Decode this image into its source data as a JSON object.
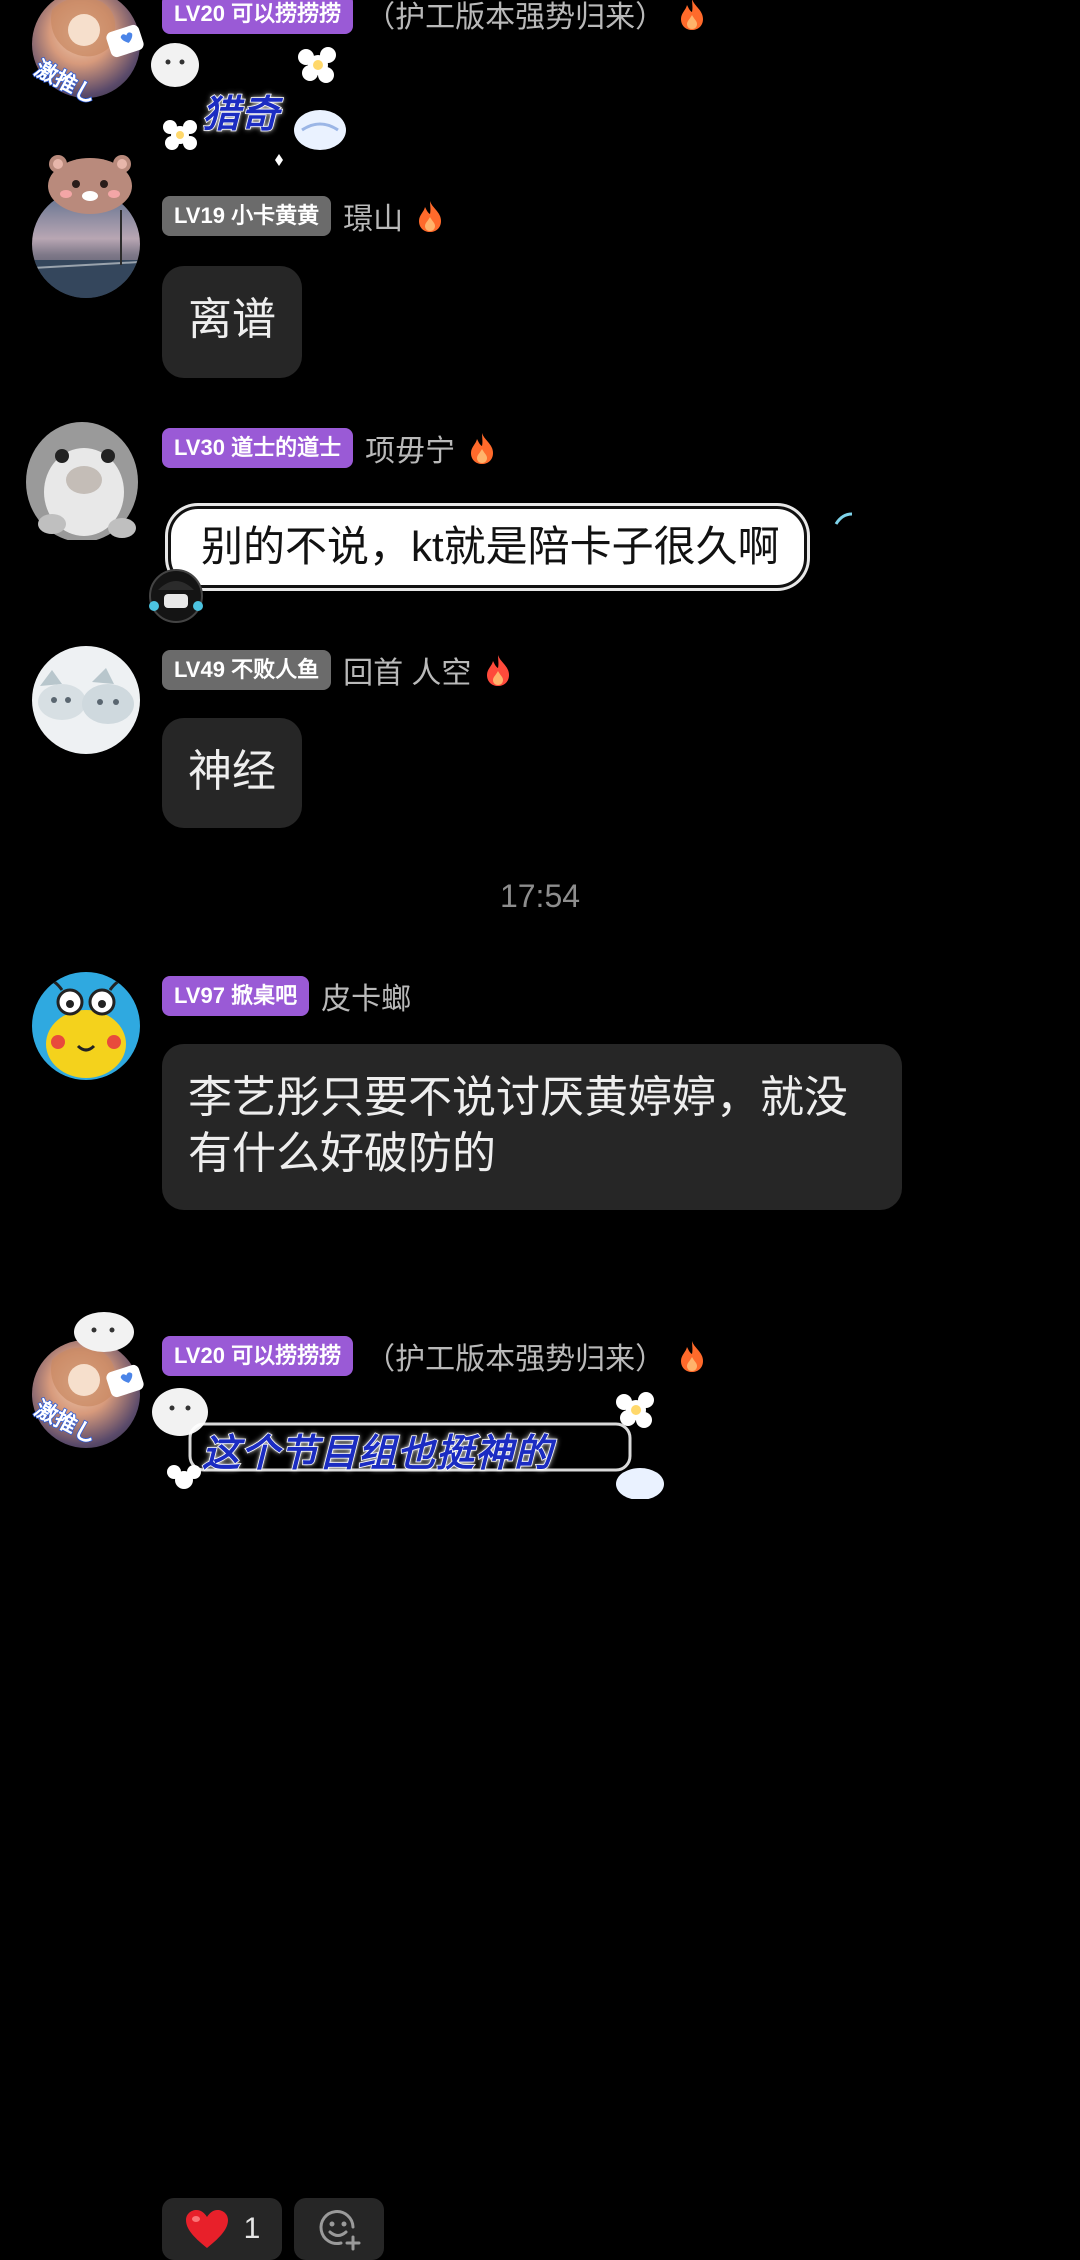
{
  "messages": [
    {
      "id": "m1",
      "badge": "LV20 可以捞捞捞",
      "name": "（护工版本强势归来）",
      "sticker_text": "猎奇",
      "frame_text": "激推し"
    },
    {
      "id": "m2",
      "badge": "LV19 小卡黄黄",
      "name": "璟山",
      "text": "离谱"
    },
    {
      "id": "m3",
      "badge": "LV30 道士的道士",
      "name": "项毋宁",
      "text": "别的不说，kt就是陪卡子很久啊"
    },
    {
      "id": "m4",
      "badge": "LV49 不败人鱼",
      "name": "回首 人空",
      "text": "神经"
    },
    {
      "id": "m5",
      "badge": "LV97 掀桌吧",
      "name": "皮卡螂",
      "text_line1": "李艺彤只要不说讨厌黄婷婷，就没",
      "text_line2": "有什么好破防的",
      "reaction_count": "1"
    },
    {
      "id": "m6",
      "badge": "LV20 可以捞捞捞",
      "name": "（护工版本强势归来）",
      "sticker_text": "这个节目组也挺神的",
      "frame_text": "激推し"
    }
  ],
  "timestamp": "17:54",
  "colors": {
    "background": "#000000",
    "badge_purple": "#9a5ad6",
    "badge_gray": "#6b6b6b",
    "bubble": "#262626",
    "name_text": "#b9b9b9",
    "flame": "#ff6a2b",
    "heart": "#e8202a"
  },
  "icons": {
    "flame": "flame-icon",
    "heart": "heart-icon",
    "add_reaction": "add-reaction-icon"
  }
}
